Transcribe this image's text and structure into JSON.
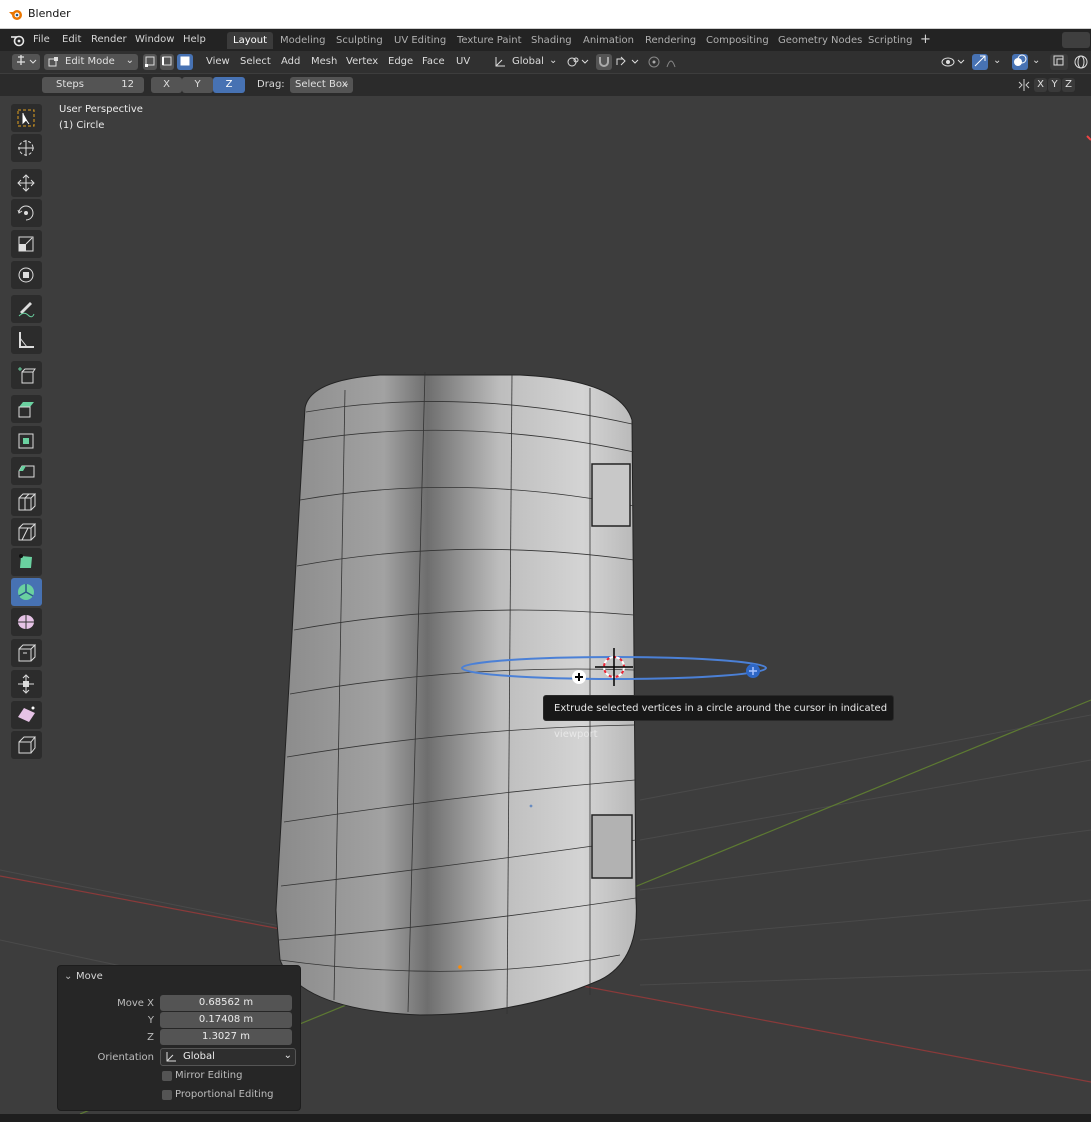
{
  "window": {
    "title": "Blender"
  },
  "menu": [
    "File",
    "Edit",
    "Render",
    "Window",
    "Help"
  ],
  "workspaces": [
    "Layout",
    "Modeling",
    "Sculpting",
    "UV Editing",
    "Texture Paint",
    "Shading",
    "Animation",
    "Rendering",
    "Compositing",
    "Geometry Nodes",
    "Scripting"
  ],
  "active_workspace": "Layout",
  "header": {
    "mode": "Edit Mode",
    "menus": [
      "View",
      "Select",
      "Add",
      "Mesh",
      "Vertex",
      "Edge",
      "Face",
      "UV"
    ],
    "orientation": "Global"
  },
  "tool_settings": {
    "steps_label": "Steps",
    "steps_value": "12",
    "axes": [
      "X",
      "Y",
      "Z"
    ],
    "active_axis": "Z",
    "drag_label": "Drag:",
    "drag_value": "Select Box",
    "mirror_axes": [
      "X",
      "Y",
      "Z"
    ]
  },
  "viewport": {
    "perspective": "User Perspective",
    "object": "(1) Circle",
    "tooltip": "Extrude selected vertices in a circle around the cursor in indicated viewport"
  },
  "tools": [
    "select-box",
    "cursor",
    "move",
    "rotate",
    "scale",
    "transform",
    "annotate",
    "measure",
    "add-cube",
    "extrude-region",
    "inset-faces",
    "bevel",
    "loop-cut",
    "knife",
    "poly-build",
    "spin",
    "smooth",
    "edge-slide",
    "shrink-fatten",
    "shear",
    "rip-region"
  ],
  "active_tool": "spin",
  "operator_panel": {
    "title": "Move",
    "move_x_label": "Move X",
    "move_x": "0.68562 m",
    "y_label": "Y",
    "y": "0.17408 m",
    "z_label": "Z",
    "z": "1.3027 m",
    "orientation_label": "Orientation",
    "orientation": "Global",
    "mirror_editing": "Mirror Editing",
    "proportional_editing": "Proportional Editing"
  },
  "colors": {
    "accent": "#4772b3",
    "viewport_bg": "#3d3d3d",
    "header_bg": "#303030"
  }
}
